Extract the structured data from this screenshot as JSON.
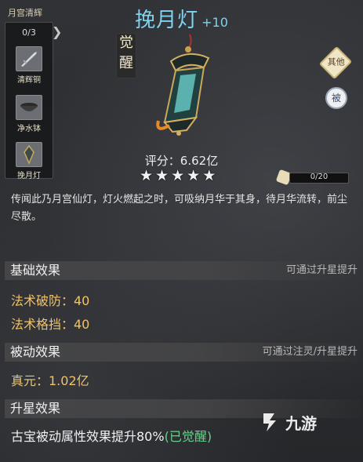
{
  "left_panel": {
    "title": "月宫清辉",
    "count": "0/3",
    "items": [
      {
        "label": "清辉铜",
        "icon": "dagger-icon"
      },
      {
        "label": "净水钵",
        "icon": "bowl-icon"
      },
      {
        "label": "挽月灯",
        "icon": "lantern-icon"
      }
    ]
  },
  "header": {
    "name": "挽月灯",
    "plus": "+10",
    "awaken_badge": "觉醒",
    "type_badge": "其他",
    "passive_badge": "被"
  },
  "score": {
    "text": "评分：6.62亿",
    "stars": 5
  },
  "shards": {
    "text": "0/20",
    "progress": 0
  },
  "description": "传闻此乃月宫仙灯，灯火燃起之时，可吸纳月华于其身，待月华流转，前尘尽散。",
  "sections": {
    "basic": {
      "title": "基础效果",
      "hint": "可通过升星提升",
      "stats": [
        "法术破防：40",
        "法术格挡：40"
      ]
    },
    "passive": {
      "title": "被动效果",
      "hint": "可通过注灵/升星提升",
      "stats": [
        "真元：1.02亿"
      ]
    },
    "star": {
      "title": "升星效果",
      "text": "古宝被动属性效果提升80%",
      "awakened": "(已觉醒)"
    }
  },
  "watermark": "九游",
  "colors": {
    "title": "#7fd3f0",
    "stat": "#f0c36a",
    "awakened": "#65d48a"
  }
}
